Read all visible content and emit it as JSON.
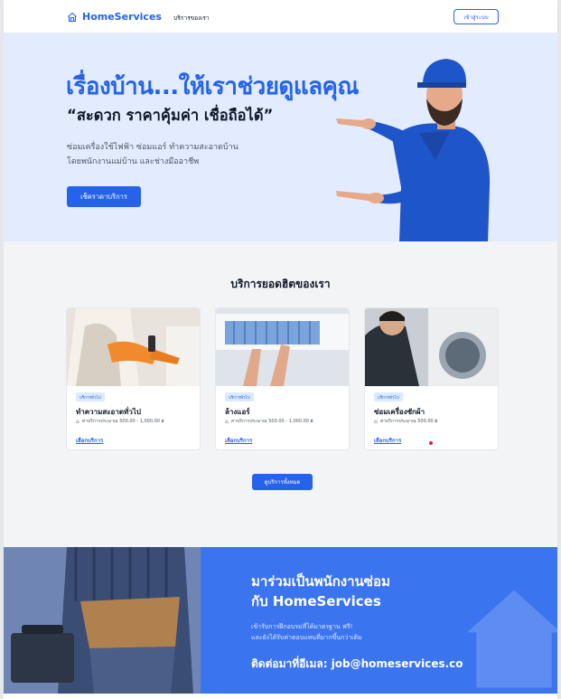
{
  "header": {
    "logo_text": "HomeServices",
    "nav_link": "บริการของเรา",
    "login_label": "เข้าสู่ระบบ"
  },
  "hero": {
    "title": "เรื่องบ้าน...ให้เราช่วยดูแลคุณ",
    "subtitle": "“สะดวก ราคาคุ้มค่า เชื่อถือได้”",
    "desc_line1": "ซ่อมเครื่องใช้ไฟฟ้า ซ่อมแอร์ ทำความสะอาดบ้าน",
    "desc_line2": "โดยพนักงานแม่บ้าน และช่างมืออาชีพ",
    "cta_label": "เช็คราคาบริการ"
  },
  "services": {
    "title": "บริการยอดฮิตของเรา",
    "cards": [
      {
        "badge": "บริการทั่วไป",
        "name": "ทำความสะอาดทั่วไป",
        "price": "ค่าบริการประมาณ 500.00 - 1,000.00 ฿",
        "link": "เลือกบริการ"
      },
      {
        "badge": "บริการทั่วไป",
        "name": "ล้างแอร์",
        "price": "ค่าบริการประมาณ 500.00 - 1,000.00 ฿",
        "link": "เลือกบริการ"
      },
      {
        "badge": "บริการทั่วไป",
        "name": "ซ่อมเครื่องซักผ้า",
        "price": "ค่าบริการประมาณ 500.00 ฿",
        "link": "เลือกบริการ"
      }
    ],
    "all_button": "ดูบริการทั้งหมด"
  },
  "recruit": {
    "title_line1": "มาร่วมเป็นพนักงานซ่อม",
    "title_line2": "กับ HomeServices",
    "desc_line1": "เข้ารับการฝึกอบรมที่ได้มาตรฐาน ฟรี!",
    "desc_line2": "และยังได้รับค่าตอบแทนที่มากขึ้นกว่าเดิม",
    "contact": "ติดต่อมาที่อีเมล: job@homeservices.co"
  },
  "colors": {
    "brand": "#2563eb",
    "hero_bg": "#e3ecff",
    "section_bg": "#f3f4f6",
    "recruit_bg": "#3b74ef"
  }
}
